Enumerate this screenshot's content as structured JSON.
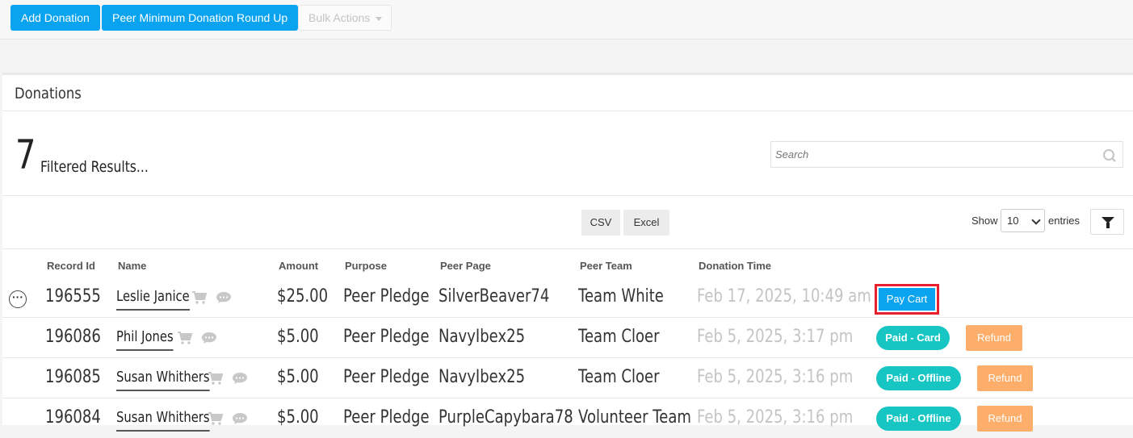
{
  "toolbar": {
    "add_donation": "Add Donation",
    "peer_round_up": "Peer Minimum Donation Round Up",
    "bulk_actions": "Bulk Actions"
  },
  "panel": {
    "title": "Donations",
    "count": "7",
    "count_label": "Filtered Results...",
    "search_placeholder": "Search",
    "csv": "CSV",
    "excel": "Excel",
    "show": "Show",
    "entries_value": "10",
    "entries": "entries"
  },
  "table": {
    "headers": [
      "Record Id",
      "Name",
      "Amount",
      "Purpose",
      "Peer Page",
      "Peer Team",
      "Donation Time"
    ],
    "rows": [
      {
        "id": "196555",
        "name": "Leslie Janice",
        "amount": "$25.00",
        "purpose": "Peer Pledge",
        "page": "SilverBeaver74",
        "team": "Team White",
        "time": "Feb 17, 2025, 10:49 am",
        "status": "Pay Cart",
        "refund": ""
      },
      {
        "id": "196086",
        "name": "Phil Jones",
        "amount": "$5.00",
        "purpose": "Peer Pledge",
        "page": "NavyIbex25",
        "team": "Team Cloer",
        "time": "Feb 5, 2025, 3:17 pm",
        "status": "Paid - Card",
        "refund": "Refund"
      },
      {
        "id": "196085",
        "name": "Susan Whithers",
        "amount": "$5.00",
        "purpose": "Peer Pledge",
        "page": "NavyIbex25",
        "team": "Team Cloer",
        "time": "Feb 5, 2025, 3:16 pm",
        "status": "Paid - Offline",
        "refund": "Refund"
      },
      {
        "id": "196084",
        "name": "Susan Whithers",
        "amount": "$5.00",
        "purpose": "Peer Pledge",
        "page": "PurpleCapybara78",
        "team": "Volunteer Team",
        "time": "Feb 5, 2025, 3:16 pm",
        "status": "Paid - Offline",
        "refund": "Refund"
      }
    ]
  },
  "colors": {
    "primary": "#0aa3f0",
    "paid_pill": "#17c5c3",
    "refund": "#fdae6b",
    "highlight": "#e8202e"
  },
  "icons": [
    "more-icon",
    "cart-icon",
    "chat-icon",
    "search-icon",
    "filter-icon",
    "caret-down-icon"
  ]
}
